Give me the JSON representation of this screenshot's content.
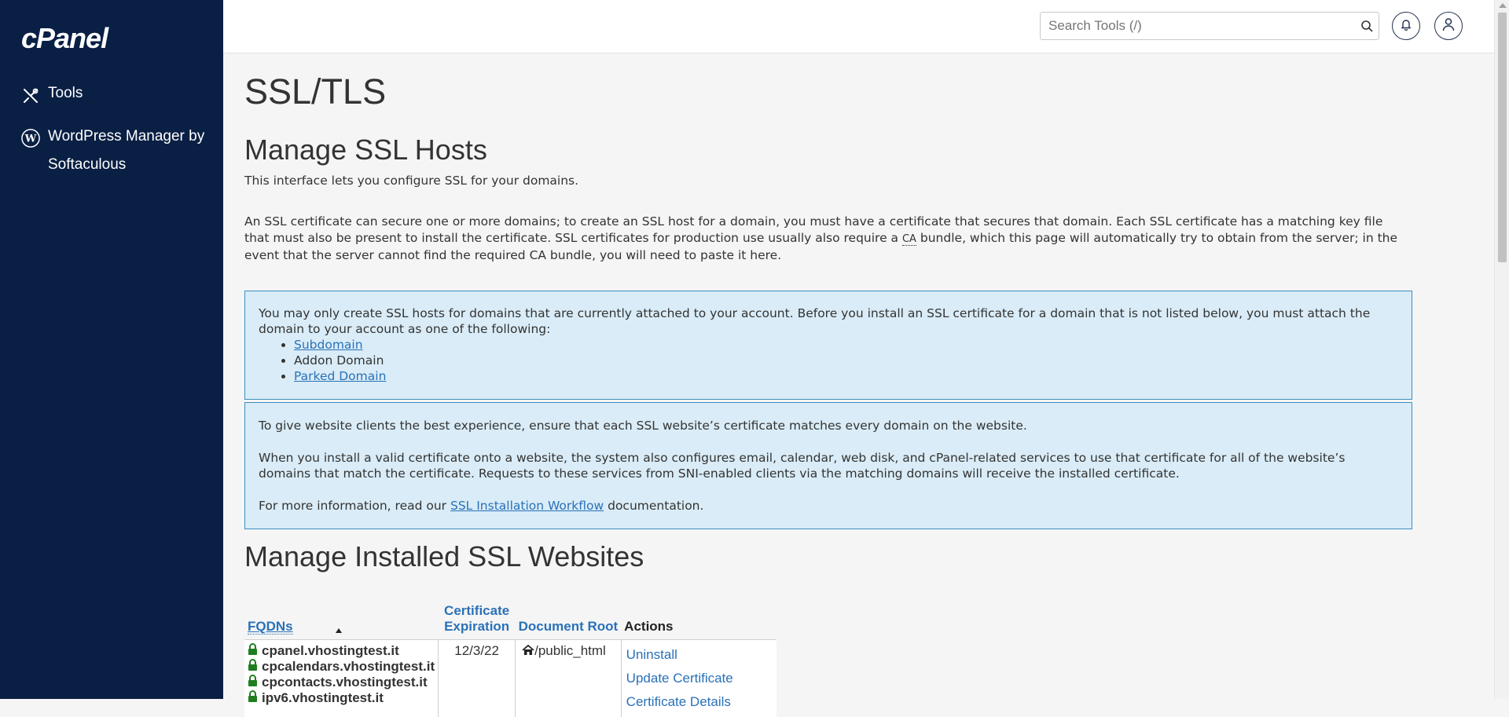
{
  "sidebar": {
    "brand": "cPanel",
    "items": [
      {
        "label": "Tools",
        "icon": "tools-icon"
      },
      {
        "label": "WordPress Manager by Softaculous",
        "icon": "wordpress-icon"
      }
    ]
  },
  "topbar": {
    "search_placeholder": "Search Tools (/)"
  },
  "main": {
    "title": "SSL/TLS",
    "hosts_heading": "Manage SSL Hosts",
    "intro": "This interface lets you configure SSL for your domains.",
    "para_before_ca": "An SSL certificate can secure one or more domains; to create an SSL host for a domain, you must have a certificate that secures that domain. Each SSL certificate has a matching key file that must also be present to install the certificate. SSL certificates for production use usually also require a ",
    "ca_abbr": "CA",
    "para_after_ca": " bundle, which this page will automatically try to obtain from the server; in the event that the server cannot find the required CA bundle, you will need to paste it here.",
    "alert1": {
      "text": "You may only create SSL hosts for domains that are currently attached to your account. Before you install an SSL certificate for a domain that is not listed below, you must attach the domain to your account as one of the following:",
      "items": [
        "Subdomain",
        "Addon Domain",
        "Parked Domain"
      ]
    },
    "alert2": {
      "p1": "To give website clients the best experience, ensure that each SSL website’s certificate matches every domain on the website.",
      "p2": "When you install a valid certificate onto a website, the system also configures email, calendar, web disk, and cPanel-related services to use that certificate for all of the website’s domains that match the certificate. Requests to these services from SNI-enabled clients via the matching domains will receive the installed certificate.",
      "p3_before": "For more information, read our ",
      "p3_link": "SSL Installation Workflow",
      "p3_after": " documentation."
    },
    "sites_heading": "Manage Installed SSL Websites",
    "table": {
      "headers": {
        "fqdns": "FQDNs",
        "exp_line1": "Certificate",
        "exp_line2": "Expiration",
        "docroot": "Document Root",
        "actions": "Actions"
      },
      "row": {
        "fqdns": [
          "cpanel.vhostingtest.it",
          "cpcalendars.vhostingtest.it",
          "cpcontacts.vhostingtest.it",
          "ipv6.vhostingtest.it"
        ],
        "expiration": "12/3/22",
        "docroot": "/public_html",
        "actions": [
          "Uninstall",
          "Update Certificate",
          "Certificate Details"
        ]
      }
    }
  },
  "colors": {
    "sidebar_bg": "#0a1f44",
    "link": "#2a71b8",
    "alert_bg": "#d9ecf7",
    "alert_border": "#3b8ec2",
    "lock_green": "#1e7e1e"
  }
}
